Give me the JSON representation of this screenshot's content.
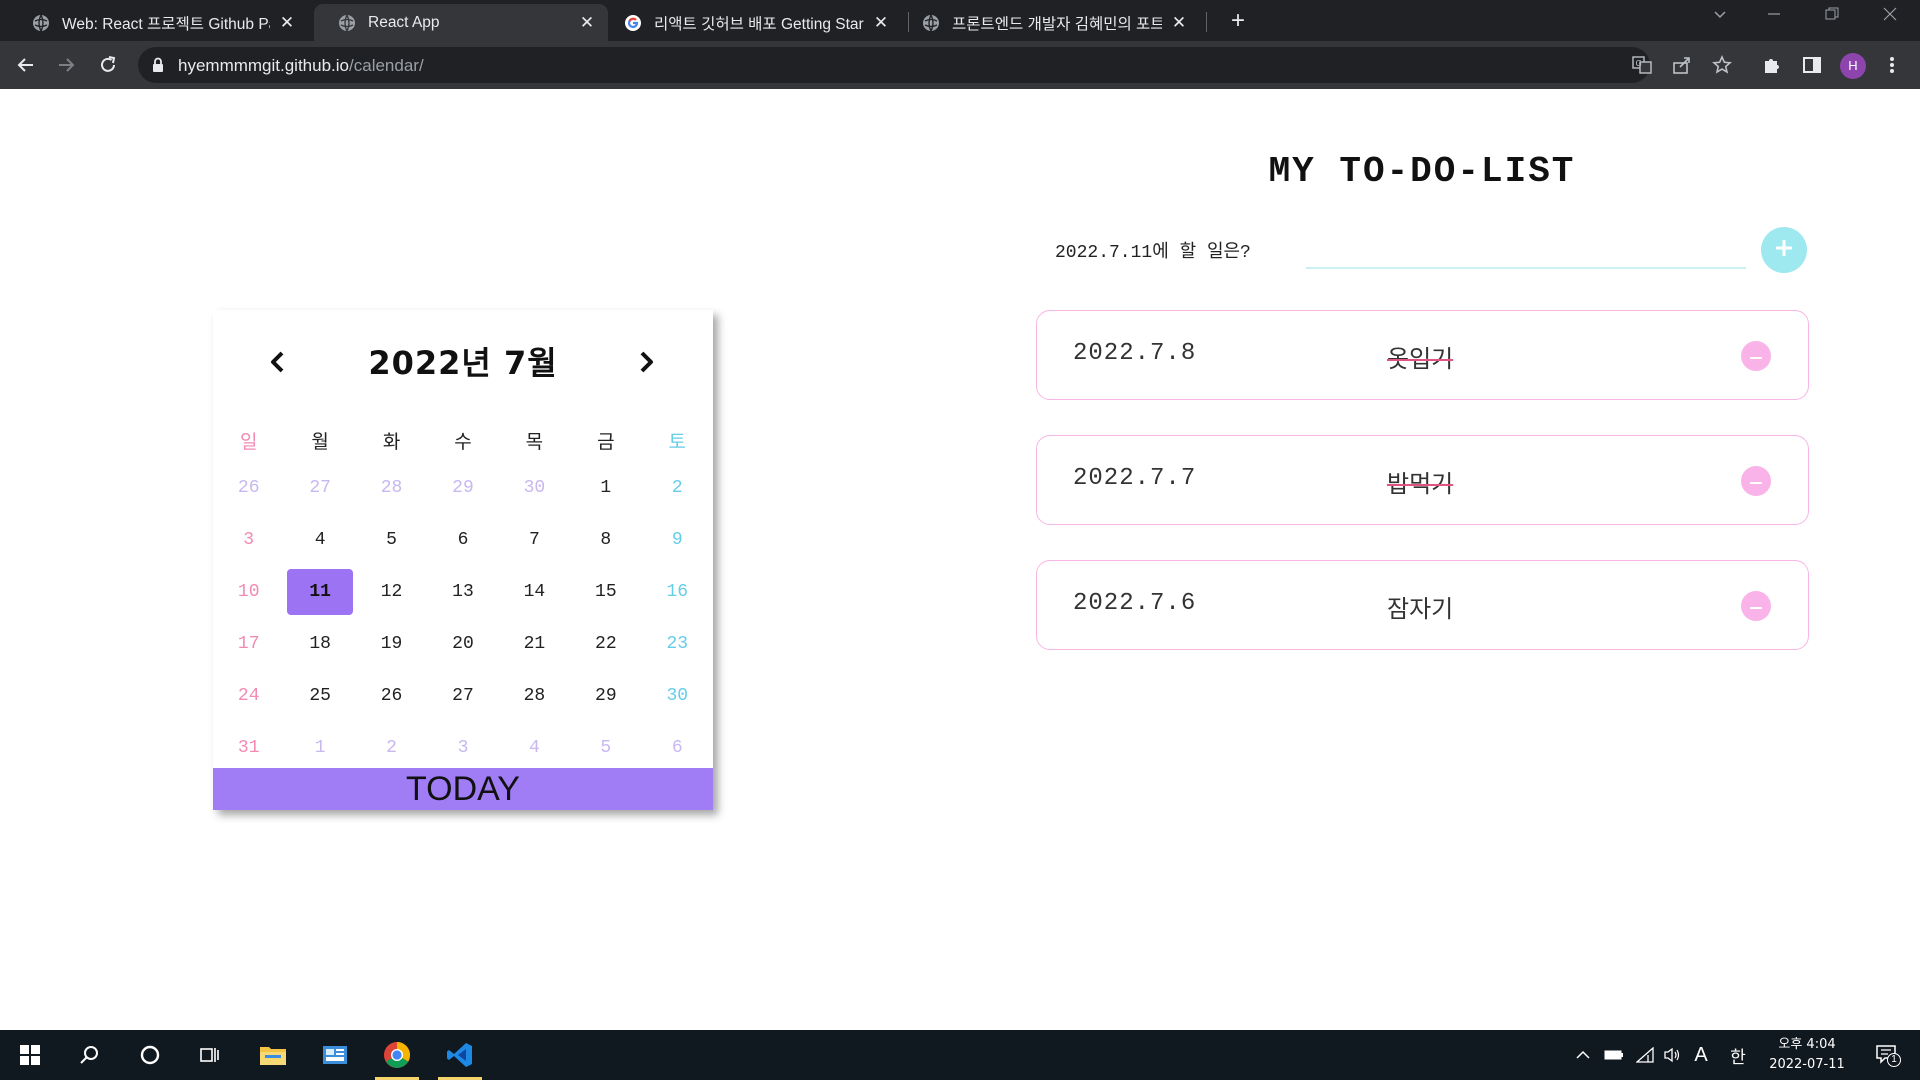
{
  "browser": {
    "tabs": [
      {
        "title": "Web: React 프로젝트 Github Pa",
        "active": false
      },
      {
        "title": "React App",
        "active": true
      },
      {
        "title": "리액트 깃허브 배포 Getting Star",
        "active": false
      },
      {
        "title": "프론트엔드 개발자 김혜민의 포트",
        "active": false
      }
    ],
    "url_host": "hyemmmmgit.github.io",
    "url_path": "/calendar/",
    "profile_initial": "H"
  },
  "calendar": {
    "title": "2022년  7월",
    "weekdays": [
      "일",
      "월",
      "화",
      "수",
      "목",
      "금",
      "토"
    ],
    "weeks": [
      [
        "26",
        "27",
        "28",
        "29",
        "30",
        "1",
        "2"
      ],
      [
        "3",
        "4",
        "5",
        "6",
        "7",
        "8",
        "9"
      ],
      [
        "10",
        "11",
        "12",
        "13",
        "14",
        "15",
        "16"
      ],
      [
        "17",
        "18",
        "19",
        "20",
        "21",
        "22",
        "23"
      ],
      [
        "24",
        "25",
        "26",
        "27",
        "28",
        "29",
        "30"
      ],
      [
        "31",
        "1",
        "2",
        "3",
        "4",
        "5",
        "6"
      ]
    ],
    "selected_day": "11",
    "today_label": "TODAY"
  },
  "todo": {
    "title": "MY TO-DO-LIST",
    "prompt": "2022.7.11에 할 일은?",
    "input_value": "",
    "items": [
      {
        "date": "2022.7.8",
        "text": "옷입기",
        "done": true
      },
      {
        "date": "2022.7.7",
        "text": "밥먹기",
        "done": true
      },
      {
        "date": "2022.7.6",
        "text": "잠자기",
        "done": false
      }
    ]
  },
  "taskbar": {
    "clock_time": "오후 4:04",
    "clock_date": "2022-07-11",
    "ime_mode": "A",
    "ime_lang": "한",
    "notification_count": "1"
  },
  "colors": {
    "accent_purple": "#9c74f3",
    "sunday": "#f28ab4",
    "saturday": "#66cde8",
    "todo_border": "#f7b6e5",
    "add_button": "#9ee8ef",
    "delete_button": "#f9b3e9"
  }
}
